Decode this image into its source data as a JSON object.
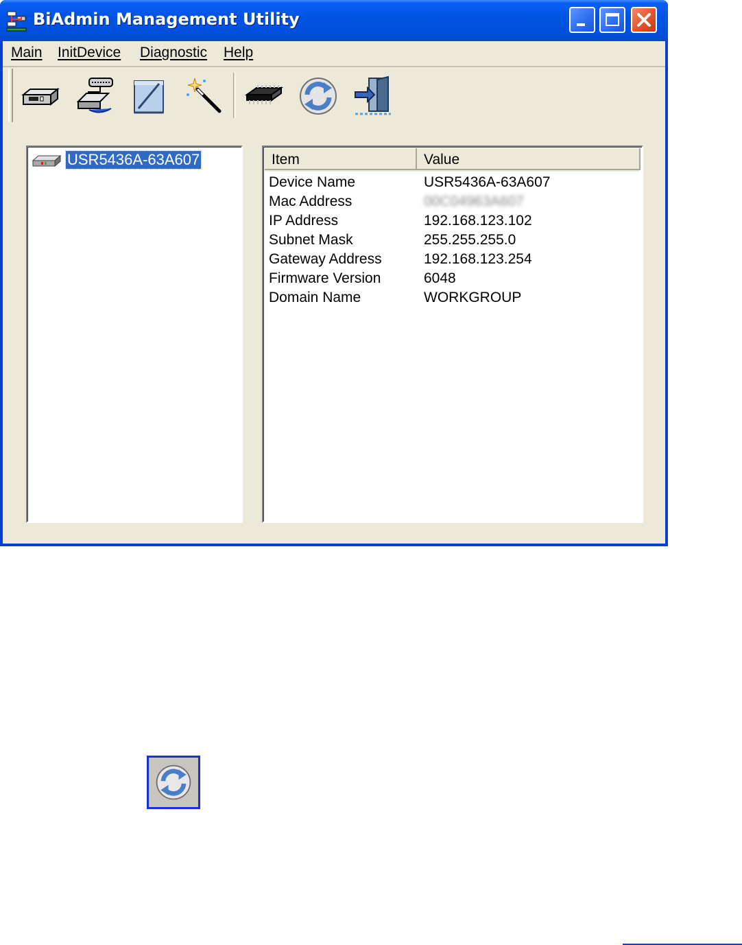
{
  "window": {
    "title": "BiAdmin Management Utility",
    "controls": [
      "minimize",
      "maximize",
      "close"
    ]
  },
  "menu": {
    "items": [
      "Main",
      "InitDevice",
      "Diagnostic",
      "Help"
    ]
  },
  "toolbar": {
    "buttons": [
      {
        "icon": "device-box-icon"
      },
      {
        "icon": "network-device-icon"
      },
      {
        "icon": "edit-pad-icon"
      },
      {
        "icon": "magic-wand-icon"
      },
      {
        "icon": "memory-chip-icon"
      },
      {
        "icon": "refresh-icon"
      },
      {
        "icon": "exit-door-icon"
      }
    ]
  },
  "tree": {
    "selected_device": "USR5436A-63A607"
  },
  "details": {
    "headers": {
      "item": "Item",
      "value": "Value"
    },
    "rows": [
      {
        "item": "Device Name",
        "value": "USR5436A-63A607"
      },
      {
        "item": "Mac Address",
        "value": "00C04963A607"
      },
      {
        "item": "IP Address",
        "value": "192.168.123.102"
      },
      {
        "item": "Subnet Mask",
        "value": "255.255.255.0"
      },
      {
        "item": "Gateway Address",
        "value": "192.168.123.254"
      },
      {
        "item": "Firmware Version",
        "value": "6048"
      },
      {
        "item": "Domain Name",
        "value": "WORKGROUP"
      }
    ]
  },
  "colors": {
    "titlebar": "#0054e3",
    "window_bg": "#ece9d8",
    "selection": "#316ac5",
    "close_button": "#e0552e",
    "highlight_border": "#1c2ed8"
  }
}
